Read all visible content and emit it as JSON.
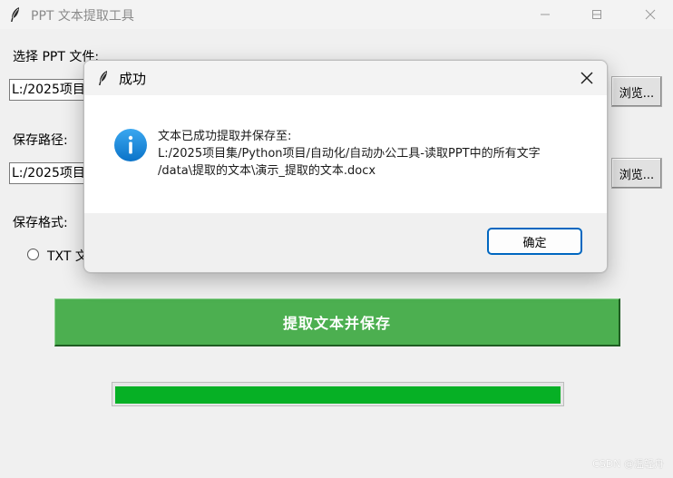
{
  "window": {
    "title": "PPT 文本提取工具"
  },
  "form": {
    "ppt_file_label": "选择 PPT 文件:",
    "ppt_file_value": "L:/2025项目",
    "browse_label_1": "浏览...",
    "save_path_label": "保存路径:",
    "save_path_value": "L:/2025项目",
    "browse_label_2": "浏览...",
    "save_format_label": "保存格式:",
    "format_option_txt": "TXT 文"
  },
  "action": {
    "extract_button_label": "提取文本并保存"
  },
  "progress": {
    "value_percent": 100
  },
  "watermark": "CSDN @温轻舟",
  "dialog": {
    "title": "成功",
    "message_lines": [
      "文本已成功提取并保存至:",
      "L:/2025项目集/Python项目/自动化/自动办公工具-读取PPT中的所有文字",
      "/data\\提取的文本\\演示_提取的文本.docx"
    ],
    "ok_label": "确定"
  },
  "colors": {
    "accent_button": "#4caf50",
    "progress_fill": "#06b025",
    "info_icon": "#1a8fe0",
    "dialog_focus_border": "#0067c0"
  },
  "icons": {
    "app_icon": "feather-icon",
    "info": "info-icon",
    "close": "close-icon",
    "minimize": "minimize-icon",
    "maximize": "maximize-icon"
  }
}
